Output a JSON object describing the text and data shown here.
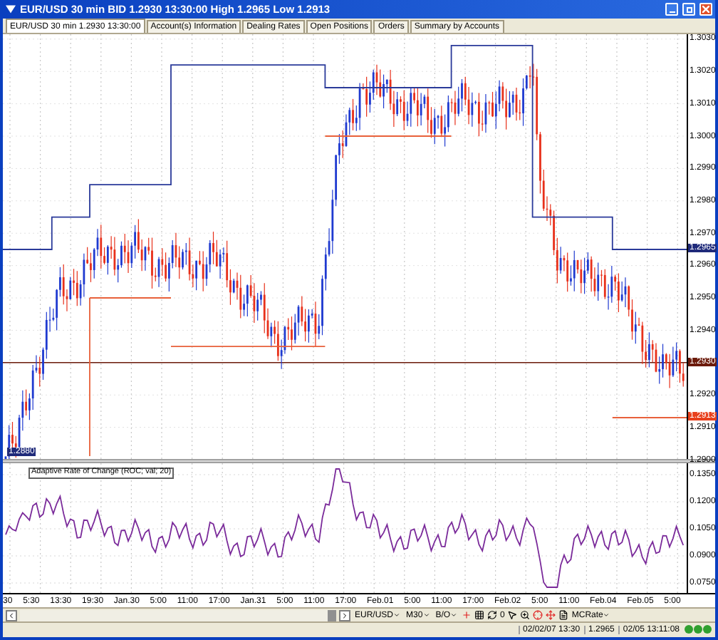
{
  "window": {
    "title": "EUR/USD 30 min BID 1.2930 13:30:00 High 1.2965 Low 1.2913"
  },
  "tabs": [
    {
      "label": "EUR/USD 30 min 1.2930 13:30:00",
      "selected": true
    },
    {
      "label": "Account(s) Information",
      "selected": false
    },
    {
      "label": "Dealing Rates",
      "selected": false
    },
    {
      "label": "Open Positions",
      "selected": false
    },
    {
      "label": "Orders",
      "selected": false
    },
    {
      "label": "Summary by Accounts",
      "selected": false
    }
  ],
  "price_axis": {
    "labels": [
      "1.3030",
      "1.3020",
      "1.3010",
      "1.3000",
      "1.2990",
      "1.2980",
      "1.2970",
      "1.2960",
      "1.2950",
      "1.2940",
      "1.2920",
      "1.2910",
      "1.2900"
    ],
    "markers": [
      {
        "label": "1.2965",
        "color": "#1f2a7a"
      },
      {
        "label": "1.2930",
        "color": "#6b1a0a"
      },
      {
        "label": "1.2913",
        "color": "#e8401c"
      }
    ]
  },
  "chart_badge": "1.2880",
  "indicator": {
    "legend": "Adaptive Rate of Change (ROC; val; 20)",
    "axis_labels": [
      "0.1350",
      "0.1200",
      "0.1050",
      "0.0900",
      "0.0750"
    ]
  },
  "time_axis": {
    "labels": [
      "30",
      "5:30",
      "13:30",
      "19:30",
      "Jan.30",
      "5:00",
      "11:00",
      "17:00",
      "Jan.31",
      "5:00",
      "11:00",
      "17:00",
      "Feb.01",
      "5:00",
      "11:00",
      "17:00",
      "Feb.02",
      "5:00",
      "11:00",
      "Feb.04",
      "Feb.05",
      "5:00"
    ]
  },
  "toolbar": {
    "selectors": [
      "EUR/USD",
      "M30",
      "B/O"
    ],
    "template": "MCRate",
    "counter": "0"
  },
  "status_bar": {
    "items": [
      "02/02/07 13:30",
      "1.2965",
      "02/05 13:11:08"
    ]
  }
}
